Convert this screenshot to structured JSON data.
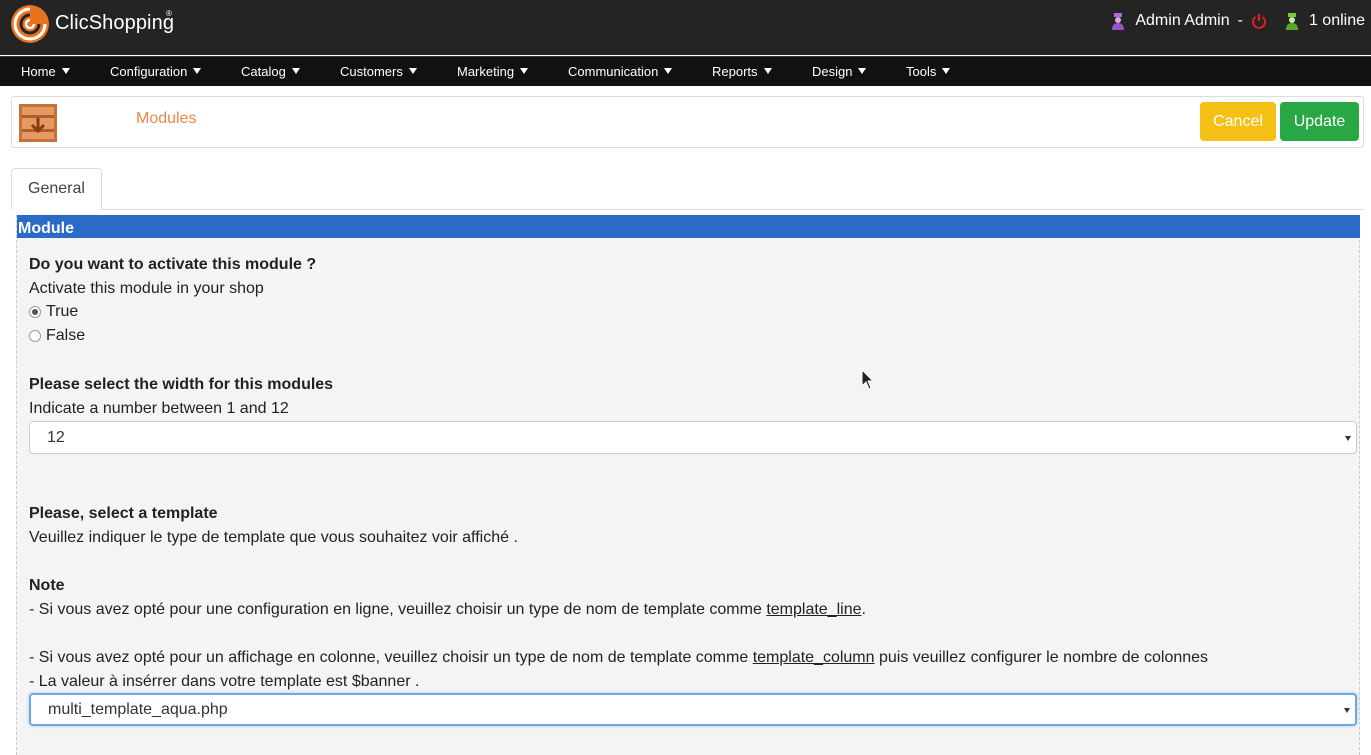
{
  "header": {
    "brand": "ClicShopping",
    "registered": "®",
    "user_name": "Admin Admin",
    "separator": "-",
    "online": "1 online"
  },
  "nav": {
    "items": [
      {
        "label": "Home"
      },
      {
        "label": "Configuration"
      },
      {
        "label": "Catalog"
      },
      {
        "label": "Customers"
      },
      {
        "label": "Marketing"
      },
      {
        "label": "Communication"
      },
      {
        "label": "Reports"
      },
      {
        "label": "Design"
      },
      {
        "label": "Tools"
      }
    ]
  },
  "page": {
    "title": "Modules",
    "cancel_label": "Cancel",
    "update_label": "Update"
  },
  "tabs": [
    {
      "label": "General"
    }
  ],
  "section": {
    "title": "Module",
    "activate": {
      "question": "Do you want to activate this module ?",
      "description": "Activate this module in your shop",
      "options": [
        "True",
        "False"
      ],
      "selected": "True"
    },
    "width": {
      "question": "Please select the width for this modules",
      "description": "Indicate a number between 1 and 12",
      "value": "12"
    },
    "template": {
      "question": "Please, select a template",
      "description": "Veuillez indiquer le type de template que vous souhaitez voir affiché .",
      "note_title": "Note",
      "note_line1_prefix": "- Si vous avez opté pour une configuration en ligne, veuillez choisir un type de nom de template comme ",
      "note_line1_link": "template_line",
      "note_line1_suffix": ".",
      "note_line2_prefix": "- Si vous avez opté pour un affichage en colonne, veuillez choisir un type de nom de template comme ",
      "note_line2_link": "template_column",
      "note_line2_suffix": " puis veuillez configurer le nombre de colonnes",
      "note_line3": "- La valeur à insérrer dans votre template est $banner .",
      "value": "multi_template_aqua.php"
    }
  },
  "colors": {
    "topbar": "#242424",
    "navbar": "#111111",
    "section_bar": "#2b6ac6",
    "title_accent": "#f0874a",
    "cancel": "#f5c016",
    "update": "#28a745"
  }
}
